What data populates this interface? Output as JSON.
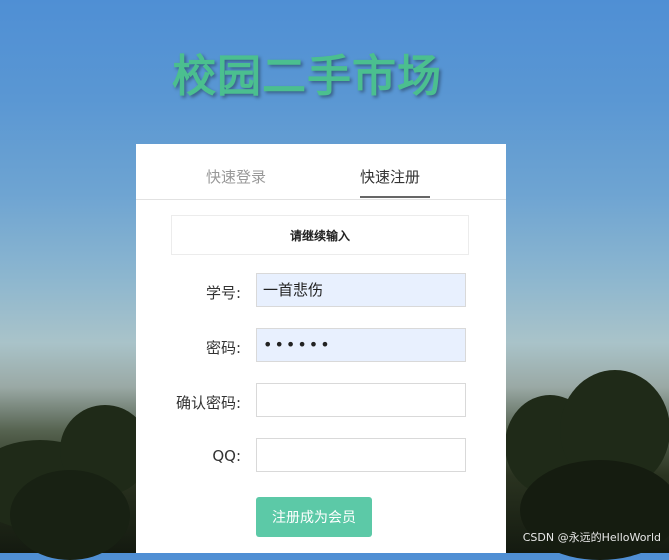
{
  "site_title": "校园二手市场",
  "tabs": [
    {
      "label": "快速登录",
      "active": false
    },
    {
      "label": "快速注册",
      "active": true
    }
  ],
  "notice": "请继续输入",
  "form": {
    "student_id_label": "学号:",
    "student_id_value": "一首悲伤",
    "password_label": "密码:",
    "password_value": "••••••",
    "confirm_label": "确认密码:",
    "confirm_value": "",
    "qq_label": "QQ:",
    "qq_value": ""
  },
  "submit_label": "注册成为会员",
  "watermark": "CSDN @永远的HelloWorld",
  "colors": {
    "accent": "#5cc9a7",
    "title": "#4bbf8f",
    "filled_input_bg": "#e8f0fe"
  }
}
